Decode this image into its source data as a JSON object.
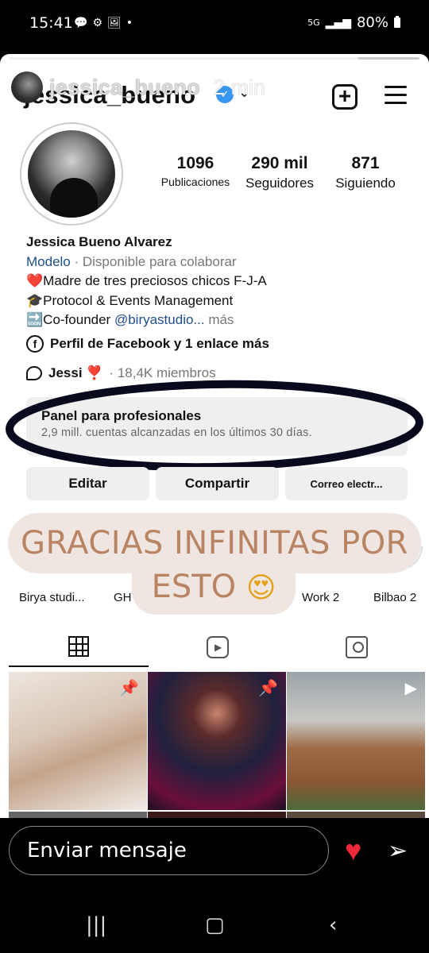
{
  "status_bar": {
    "time": "15:41",
    "left_icons": [
      "chat-bubble-icon",
      "settings-icon",
      "image-icon",
      "dot"
    ],
    "network": "5G",
    "battery": "80%"
  },
  "story": {
    "username": "jessica_bueno",
    "time_ago": "2 min",
    "progress": 0.85
  },
  "profile": {
    "username": "jessica_bueno",
    "stats": [
      {
        "value": "1096",
        "label": "Publicaciones"
      },
      {
        "value": "290 mil",
        "label": "Seguidores"
      },
      {
        "value": "871",
        "label": "Siguiendo"
      }
    ],
    "full_name": "Jessica Bueno Alvarez",
    "category": "Modelo",
    "availability": " · Disponible para colaborar",
    "bio_line1": "❤️Madre de tres preciosos chicos F-J-A",
    "bio_line2": "🎓Protocol & Events Management",
    "bio_line3_prefix": "🔜Co-founder ",
    "bio_line3_link": "@biryastudio...",
    "bio_more": " más",
    "facebook_link": "Perfil de Facebook y 1 enlace más",
    "thread_name": "Jessi ❣️",
    "thread_members": " · 18,4K miembros"
  },
  "panel": {
    "title": "Panel para profesionales",
    "subtitle": "2,9 mill. cuentas alcanzadas en los últimos 30 días."
  },
  "buttons": {
    "edit": "Editar",
    "share": "Compartir",
    "email": "Correo electr..."
  },
  "highlights": [
    "Birya studi...",
    "GH",
    "Work 2",
    "Bilbao 2"
  ],
  "overlay": {
    "line1": "GRACIAS INFINITAS POR",
    "line2": "ESTO",
    "emoji": "😍"
  },
  "reply": {
    "placeholder": "Enviar mensaje"
  },
  "colors": {
    "verified": "#3897f0",
    "heart": "#ee2a3a",
    "overlay_bg": "#efe6e2",
    "overlay_text": "#b98463"
  }
}
